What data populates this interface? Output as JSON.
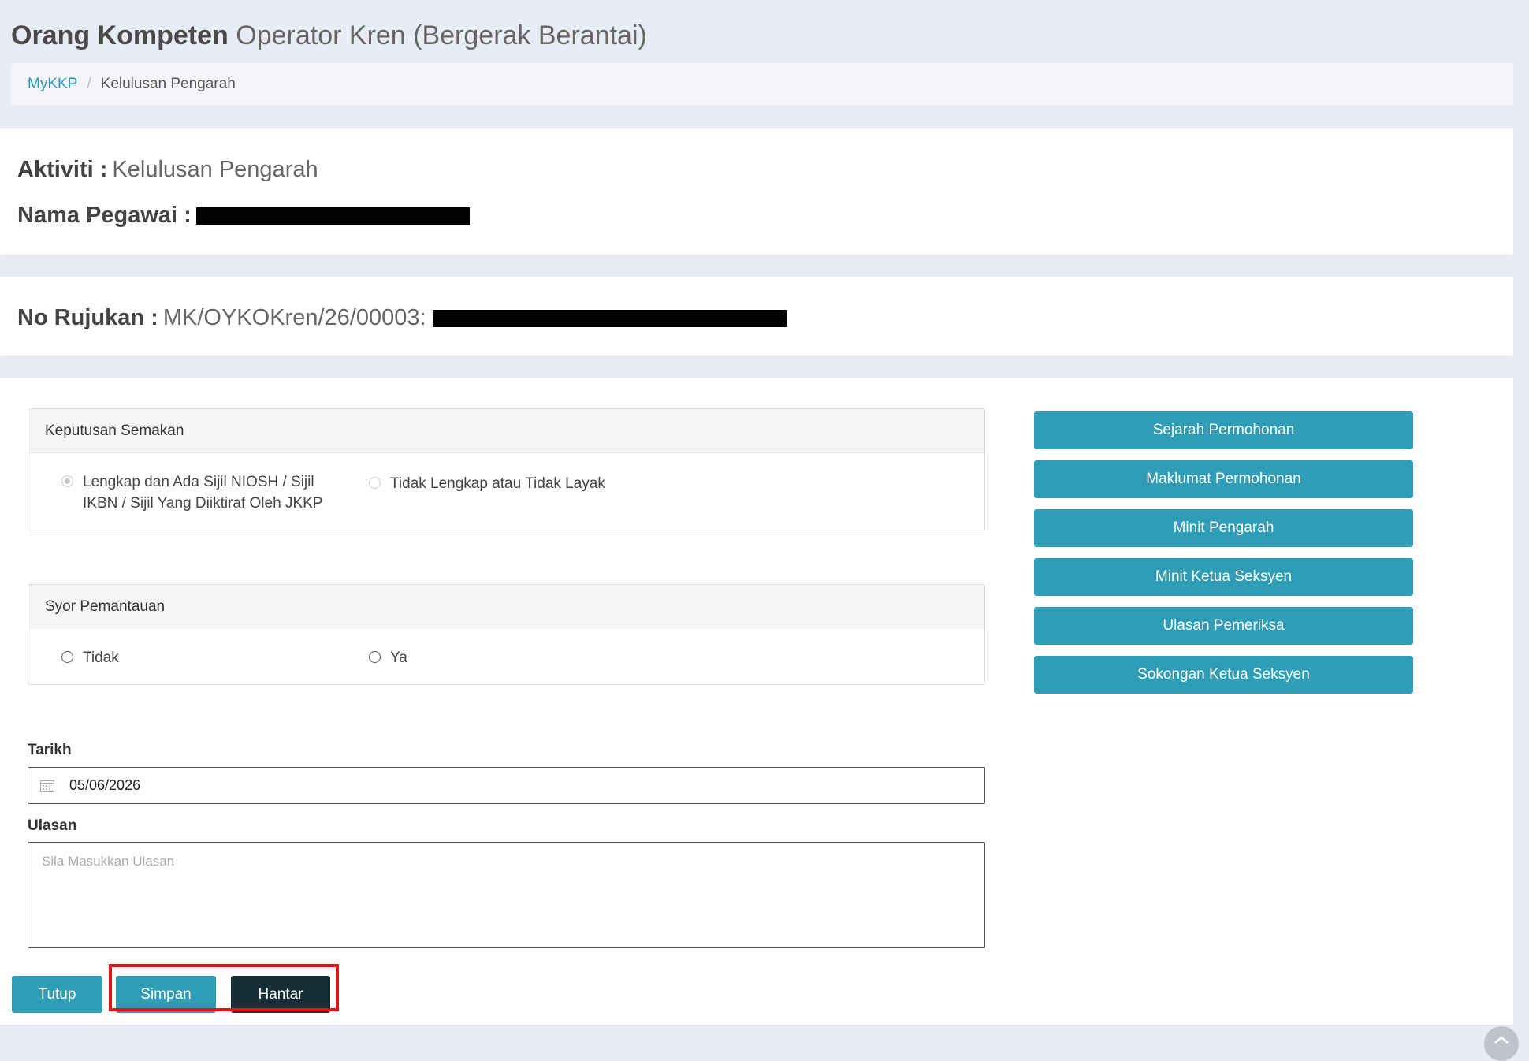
{
  "header": {
    "title_bold": "Orang Kompeten",
    "title_light": "Operator Kren (Bergerak Berantai)"
  },
  "breadcrumb": {
    "home": "MyKKP",
    "separator": "/",
    "current": "Kelulusan Pengarah"
  },
  "info": {
    "aktiviti_label": "Aktiviti :",
    "aktiviti_value": "Kelulusan Pengarah",
    "nama_label": "Nama Pegawai :"
  },
  "ref": {
    "label": "No Rujukan :",
    "value": "MK/OYKOKren/26/00003:"
  },
  "keputusan": {
    "title": "Keputusan Semakan",
    "option1_line1": "Lengkap dan Ada Sijil NIOSH / Sijil",
    "option1_line2": "IKBN / Sijil Yang Diiktiraf Oleh JKKP",
    "option2": "Tidak Lengkap atau Tidak Layak"
  },
  "syor": {
    "title": "Syor Pemantauan",
    "option1": "Tidak",
    "option2": "Ya"
  },
  "side_buttons": [
    "Sejarah Permohonan",
    "Maklumat Permohonan",
    "Minit Pengarah",
    "Minit Ketua Seksyen",
    "Ulasan Pemeriksa",
    "Sokongan Ketua Seksyen"
  ],
  "form": {
    "tarikh_label": "Tarikh",
    "tarikh_value": "05/06/2026",
    "ulasan_label": "Ulasan",
    "ulasan_placeholder": "Sila Masukkan Ulasan"
  },
  "actions": {
    "tutup": "Tutup",
    "simpan": "Simpan",
    "hantar": "Hantar"
  },
  "colors": {
    "primary": "#2e9db5",
    "dark": "#142d37",
    "highlight": "#e1141a",
    "background": "#e9ecf5"
  }
}
